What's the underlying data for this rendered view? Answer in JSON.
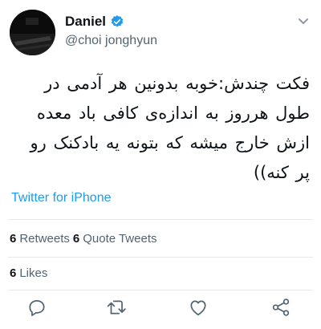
{
  "author": {
    "name": "Daniel",
    "handle": "@choi jonghyun",
    "verified": true
  },
  "tweet": {
    "text": "فکت چندش:خوبه بدونین هر آدمی در طول هرروز به اندازه‌ی کافی باد معده ازش خارج میشه که بتونه یه بادکنک رو پر کنه))",
    "source": "Twitter for iPhone"
  },
  "stats": {
    "retweets_count": "6",
    "retweets_label": "Retweets",
    "quote_tweets_count": "6",
    "quote_tweets_label": "Quote Tweets",
    "likes_count": "6",
    "likes_label": "Likes"
  },
  "actions": [
    "reply-icon",
    "retweet-icon",
    "like-icon",
    "share-icon"
  ],
  "colors": {
    "link": "#1d9bf0",
    "text": "#0f1419",
    "secondary": "#536471",
    "divider": "#e7e9ea"
  }
}
